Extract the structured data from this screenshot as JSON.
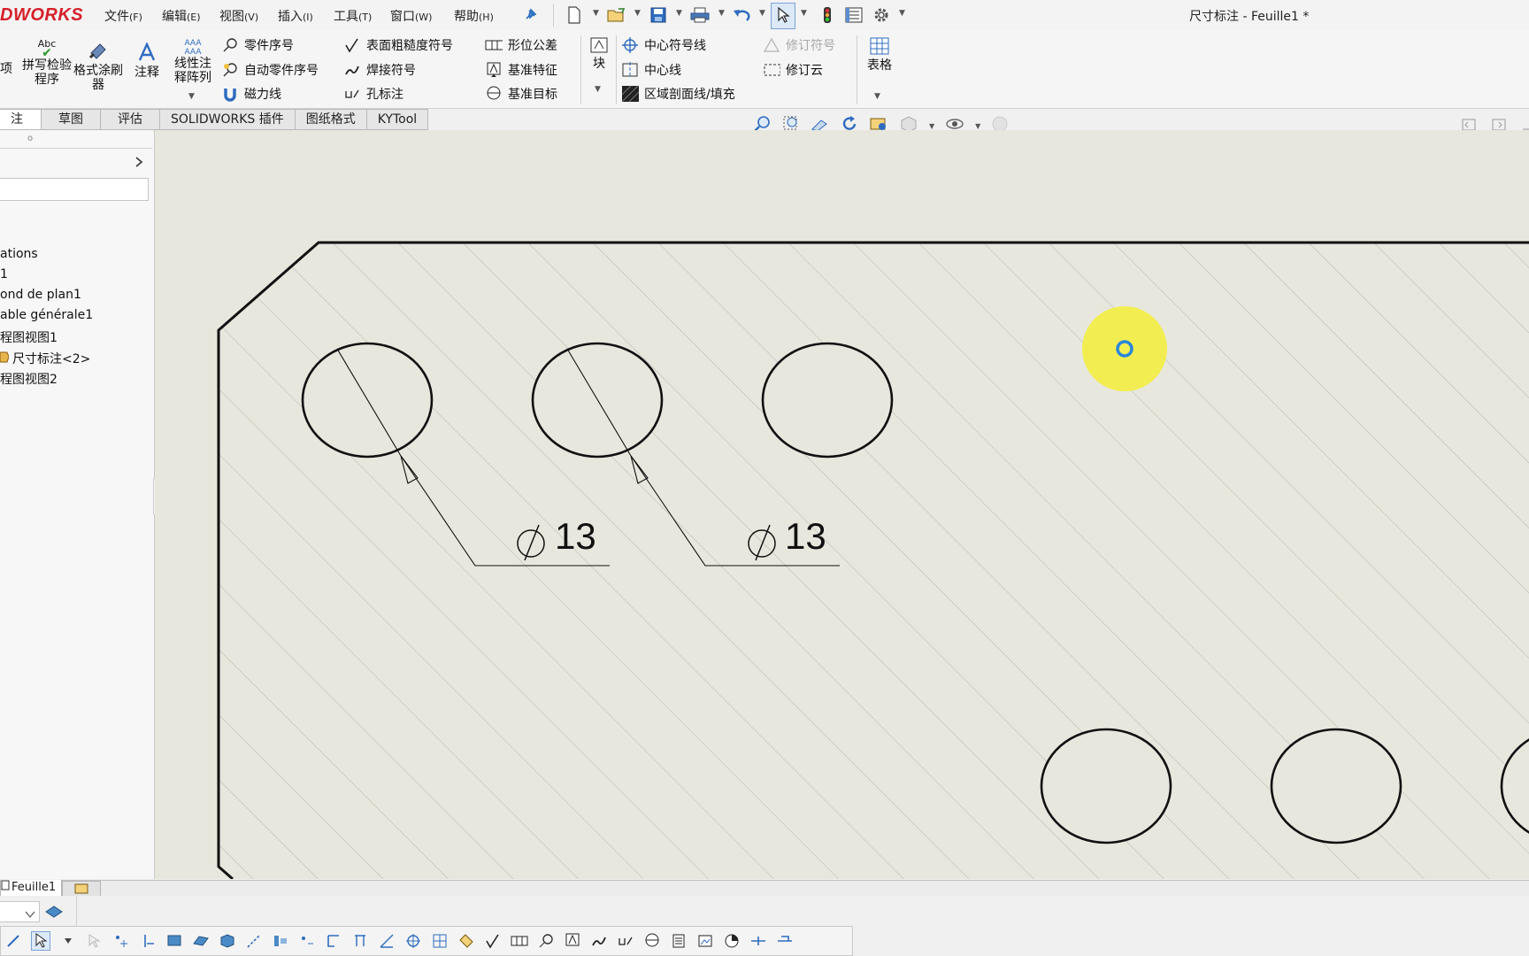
{
  "app": {
    "logo": "DWORKS",
    "document_title": "尺寸标注 - Feuille1 *"
  },
  "menu": [
    {
      "label": "文件",
      "key": "(F)"
    },
    {
      "label": "编辑",
      "key": "(E)"
    },
    {
      "label": "视图",
      "key": "(V)"
    },
    {
      "label": "插入",
      "key": "(I)"
    },
    {
      "label": "工具",
      "key": "(T)"
    },
    {
      "label": "窗口",
      "key": "(W)"
    },
    {
      "label": "帮助",
      "key": "(H)"
    }
  ],
  "ribbon": {
    "partial_left": "项",
    "spell_check": "拼写检验程序",
    "format_painter": "格式涂刷器",
    "note": "注释",
    "linear_note_pattern": "线性注释阵列",
    "balloon": "零件序号",
    "auto_balloon": "自动零件序号",
    "magnetic_line": "磁力线",
    "surface_finish": "表面粗糙度符号",
    "weld_symbol": "焊接符号",
    "hole_callout": "孔标注",
    "geometric_tolerance": "形位公差",
    "datum_feature": "基准特征",
    "datum_target": "基准目标",
    "block": "块",
    "center_mark": "中心符号线",
    "centerline": "中心线",
    "area_hatch": "区域剖面线/填充",
    "revision_symbol": "修订符号",
    "revision_cloud": "修订云",
    "table": "表格"
  },
  "tabs": [
    "注解",
    "草图",
    "评估",
    "SOLIDWORKS 插件",
    "图纸格式",
    "KYTool"
  ],
  "tree": [
    "ations",
    "1",
    "ond de plan1",
    "able générale1",
    "程图视图1",
    "尺寸标注<2>",
    "程图视图2"
  ],
  "dimensions": [
    "13",
    "13"
  ],
  "sheet_tab": "Feuille1",
  "colors": {
    "canvas": "#e8e7dd",
    "cursor_highlight": "#f3ef3a",
    "cursor_ring": "#2a86d8",
    "logo": "#d6202a"
  }
}
